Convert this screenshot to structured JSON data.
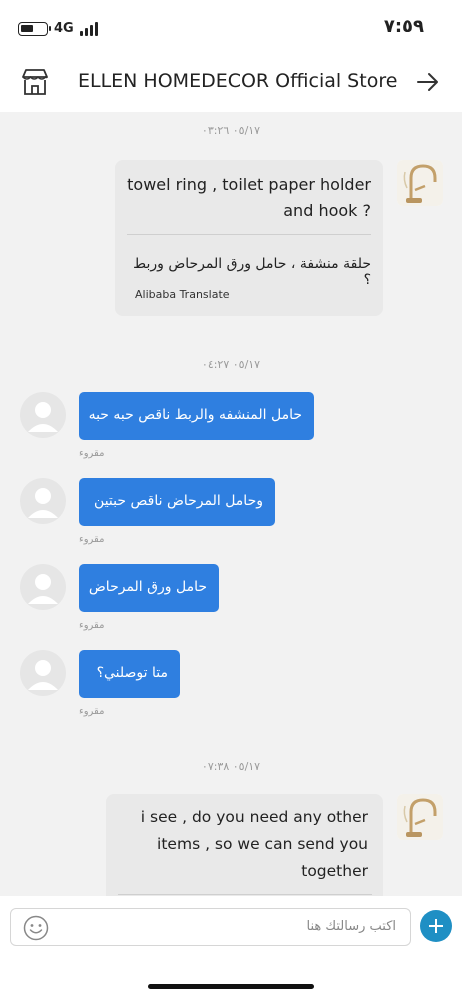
{
  "status_bar": {
    "network": "4G",
    "time": "٧:٥٩"
  },
  "header": {
    "title": "ELLEN HOMEDECOR Official Store",
    "store_icon": "store-icon",
    "go_icon": "arrow-right-icon"
  },
  "messages": [
    {
      "timestamp": "٠٥/١٧ ٠٣:٢٦"
    },
    {
      "sender": "store",
      "text": [
        "towel ring , toilet paper holder",
        "and hook ?"
      ],
      "translation": "حلقة منشفة ، حامل ورق المرحاض وربط ؟",
      "credit": "Alibaba Translate"
    },
    {
      "timestamp": "٠٥/١٧ ٠٤:٢٧"
    },
    {
      "sender": "user",
      "text": "حامل المنشفه والربط ناقص حبه حبه",
      "status": "مقروء"
    },
    {
      "sender": "user",
      "text": "وحامل المرحاض ناقص حبتين",
      "status": "مقروء"
    },
    {
      "sender": "user",
      "text": "حامل ورق المرحاض",
      "status": "مقروء"
    },
    {
      "sender": "user",
      "text": "متا توصلني؟",
      "status": "مقروء"
    },
    {
      "timestamp": "٠٥/١٧ ٠٧:٣٨"
    },
    {
      "sender": "store",
      "text": [
        "i see , do you need any other",
        "items , so we can send you",
        "together"
      ]
    }
  ],
  "input": {
    "placeholder": "اكتب رسالتك هنا",
    "emoji_icon": "smiley-icon",
    "add_icon": "plus-icon"
  },
  "colors": {
    "accent_blue": "#2f7fe0",
    "add_button": "#1f8fc4",
    "bubble_gray": "#e9e9e9",
    "background": "#f2f2f2"
  }
}
